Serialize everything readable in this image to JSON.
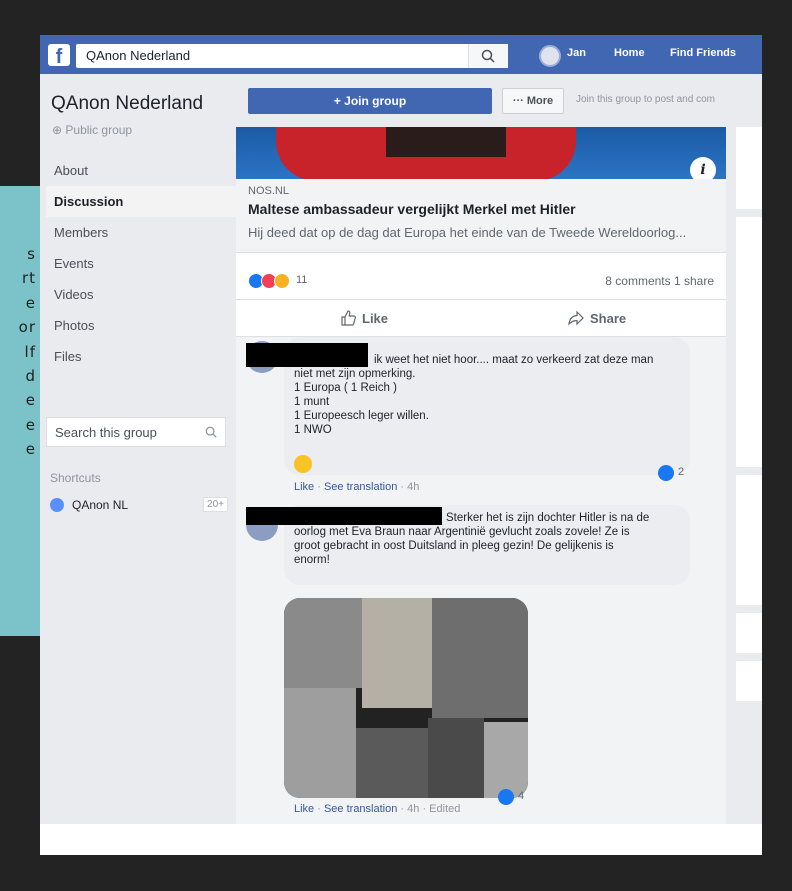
{
  "side_caption": [
    "s",
    "rt",
    "e",
    "or",
    "lf",
    "d",
    "e",
    "e",
    "e"
  ],
  "topbar": {
    "logo": "f",
    "search_value": "QAnon Nederland",
    "user_name": "Jan",
    "home": "Home",
    "find_friends": "Find Friends"
  },
  "group": {
    "name": "QAnon Nederland",
    "type": "Public group",
    "nav": [
      "About",
      "Discussion",
      "Members",
      "Events",
      "Videos",
      "Photos",
      "Files"
    ],
    "active_nav": "Discussion",
    "search_placeholder": "Search this group",
    "shortcuts_label": "Shortcuts",
    "shortcut_name": "QAnon NL",
    "shortcut_count": "20+"
  },
  "actions": {
    "join": "+ Join group",
    "more": "··· More",
    "join_note": "Join this group to post and com"
  },
  "post": {
    "source": "NOS.NL",
    "title": "Maltese ambassadeur vergelijkt Merkel met Hitler",
    "description": "Hij deed dat op de dag dat Europa het einde van de Tweede Wereldoorlog...",
    "reaction_count": "11",
    "comments_shares": "8 comments  1 share",
    "like": "Like",
    "share": "Share"
  },
  "comments": [
    {
      "lines": [
        "ik weet het niet hoor.... maat zo verkeerd zat deze man",
        "niet met zijn opmerking.",
        "1 Europa ( 1 Reich )",
        "1 munt",
        "1 Europeesch leger willen.",
        "1 NWO"
      ],
      "meta_like": "Like",
      "meta_translate": "See translation",
      "meta_time": "4h",
      "reactions": "2"
    },
    {
      "lines": [
        "Sterker het is zijn dochter Hitler is na de",
        "oorlog met Eva Braun naar Argentinië gevlucht zoals zovele! Ze is",
        "groot gebracht in oost Duitsland in pleeg gezin! De gelijkenis is",
        "enorm!"
      ],
      "meta_like": "Like",
      "meta_translate": "See translation",
      "meta_time": "4h",
      "meta_edited": "Edited",
      "reactions": "4"
    }
  ],
  "colors": {
    "fb_blue": "#4267b2",
    "caption_bg": "#7bc3c8",
    "frame": "#232323"
  }
}
